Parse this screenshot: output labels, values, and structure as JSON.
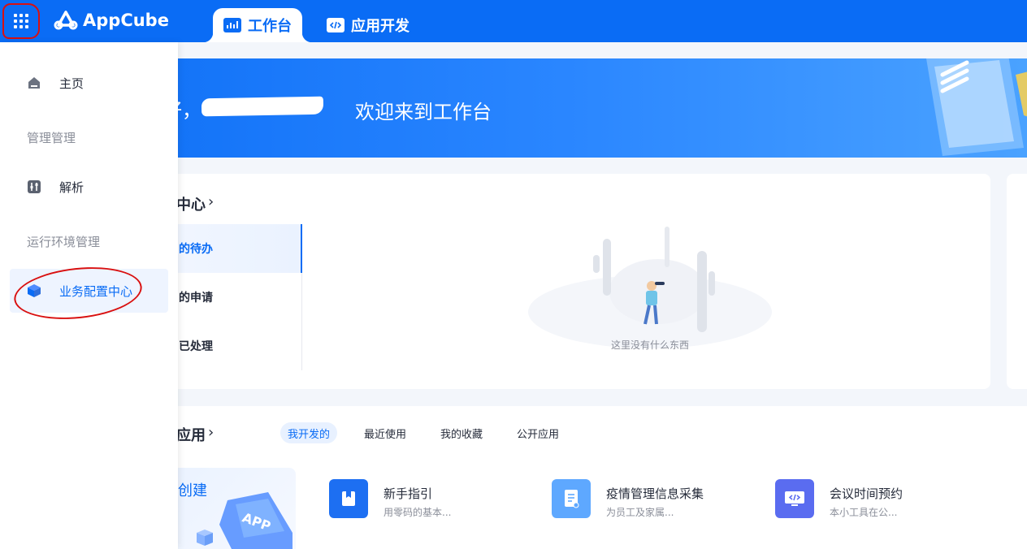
{
  "app": {
    "brand": "AppCube"
  },
  "topbar": {
    "tabs": [
      {
        "label": "工作台",
        "icon": "dashboard-icon",
        "active": true
      },
      {
        "label": "应用开发",
        "icon": "code-icon",
        "active": false
      }
    ]
  },
  "banner": {
    "greeting": "好，",
    "welcome": "欢迎来到工作台"
  },
  "todo": {
    "title": "中心",
    "tabs": [
      {
        "label": "的待办",
        "active": true
      },
      {
        "label": "的申请",
        "active": false
      },
      {
        "label": "已处理",
        "active": false
      }
    ],
    "empty_text": "这里没有什么东西"
  },
  "apps": {
    "title": "应用",
    "filters": [
      {
        "label": "我开发的",
        "active": true
      },
      {
        "label": "最近使用",
        "active": false
      },
      {
        "label": "我的收藏",
        "active": false
      },
      {
        "label": "公开应用",
        "active": false
      }
    ],
    "create_label": "创建",
    "items": [
      {
        "name": "新手指引",
        "desc": "用零码的基本...",
        "icon": "bookmark-icon",
        "color": "#1d6ff2"
      },
      {
        "name": "疫情管理信息采集",
        "desc": "为员工及家属...",
        "icon": "document-icon",
        "color": "#5ea8ff"
      },
      {
        "name": "会议时间预约",
        "desc": "本小工具在公...",
        "icon": "monitor-code-icon",
        "color": "#5a6cf0"
      }
    ]
  },
  "sidebar": {
    "items": [
      {
        "label": "主页",
        "type": "item",
        "icon": "home-icon"
      },
      {
        "label": "管理管理",
        "type": "group"
      },
      {
        "label": "解析",
        "type": "item",
        "icon": "sliders-icon"
      },
      {
        "label": "运行环境管理",
        "type": "group"
      },
      {
        "label": "业务配置中心",
        "type": "item",
        "icon": "cube-icon",
        "active": true
      }
    ]
  },
  "colors": {
    "primary": "#0a6cf5",
    "annotation": "#d91010"
  }
}
